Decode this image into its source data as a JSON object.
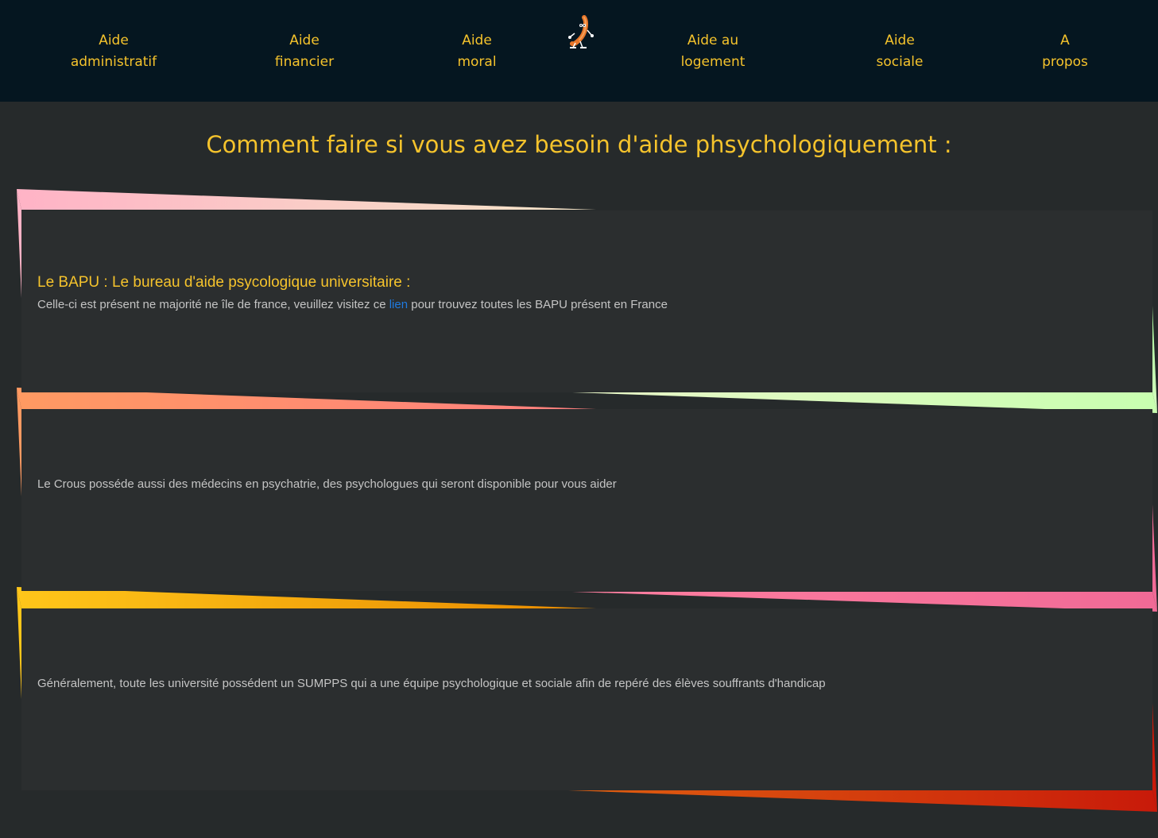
{
  "nav": {
    "items": [
      {
        "line1": "Aide",
        "line2": "administratif"
      },
      {
        "line1": "Aide",
        "line2": "financier"
      },
      {
        "line1": "Aide",
        "line2": "moral"
      },
      {
        "line1": "Aide au",
        "line2": "logement"
      },
      {
        "line1": "Aide",
        "line2": "sociale"
      },
      {
        "line1": "A",
        "line2": "propos"
      }
    ],
    "logo_icon": "dancing-sausage-logo-icon"
  },
  "page": {
    "title": "Comment faire si vous avez besoin d'aide phsychologiquement :"
  },
  "cards": [
    {
      "heading": "Le BAPU : Le bureau d'aide psycologique universitaire :",
      "text_before": "Celle-ci est présent ne majorité ne île de france, veuillez visitez ce ",
      "link_label": "lien",
      "text_after": " pour trouvez toutes les BAPU présent en France"
    },
    {
      "text": "Le Crous posséde aussi des médecins en psychatrie, des psychologues qui seront disponible pour vous aider"
    },
    {
      "text": "Généralement, toute les université possédent un SUMPPS qui a une équipe psychologique et sociale afin de repéré des élèves souffrants d'handicap"
    }
  ],
  "colors": {
    "nav_bg": "#051620",
    "page_bg": "#262a2b",
    "card_bg": "#2b2e2f",
    "accent": "#f5c32c",
    "body_text": "#c4c4c4",
    "link": "#1f7ae0"
  }
}
